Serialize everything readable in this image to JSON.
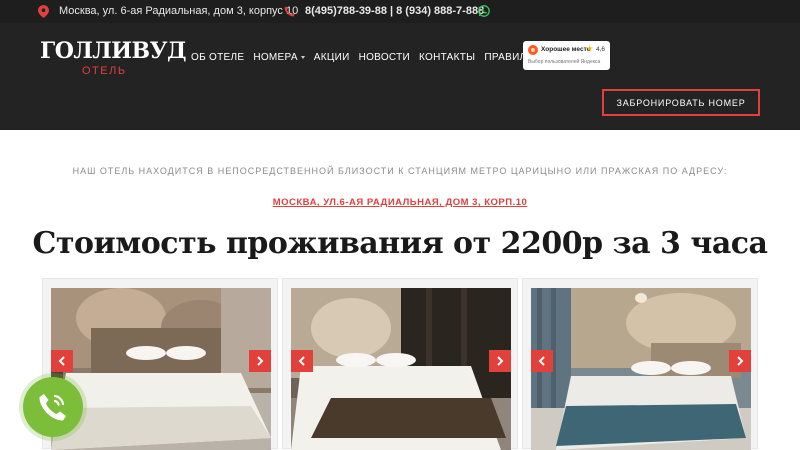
{
  "topbar": {
    "address": "Москва, ул. 6-ая Радиальная, дом 3, корпус 10",
    "phones": "8(495)788-39-88 | 8 (934) 888-7-888"
  },
  "header": {
    "logo_title": "ГОЛЛИВУД",
    "logo_subtitle": "ОТЕЛЬ",
    "nav": [
      "ОБ ОТЕЛЕ",
      "НОМЕРА",
      "АКЦИИ",
      "НОВОСТИ",
      "КОНТАКТЫ",
      "ПРАВИЛА"
    ],
    "badge": {
      "title": "Хорошее место",
      "rating": "4,6",
      "subtitle": "Выбор пользователей Яндекса"
    },
    "book_button": "ЗАБРОНИРОВАТЬ НОМЕР"
  },
  "main": {
    "intro": "НАШ ОТЕЛЬ НАХОДИТСЯ В НЕПОСРЕДСТВЕННОЙ БЛИЗОСТИ К СТАНЦИЯМ МЕТРО ЦАРИЦЫНО ИЛИ ПРАЖСКАЯ ПО АДРЕСУ:",
    "address_link": "МОСКВА, УЛ.6-АЯ РАДИАЛЬНАЯ, ДОМ 3, КОРП.10",
    "headline": "Стоимость проживания от 2200р за 3 часа"
  },
  "colors": {
    "accent": "#e2403b",
    "header_bg": "#232323",
    "topbar_bg": "#1e1e1e",
    "call_button": "#7cbd3a"
  }
}
